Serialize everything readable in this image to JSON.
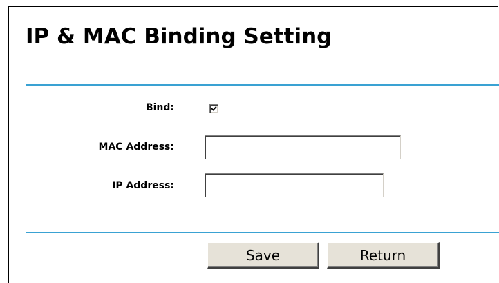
{
  "page": {
    "title": "IP & MAC Binding Setting"
  },
  "form": {
    "bind": {
      "label": "Bind:",
      "checked": true
    },
    "mac_address": {
      "label": "MAC Address:",
      "value": ""
    },
    "ip_address": {
      "label": "IP Address:",
      "value": ""
    }
  },
  "buttons": {
    "save_label": "Save",
    "return_label": "Return"
  },
  "colors": {
    "divider": "#3aa2d3",
    "button_face": "#e6e2d8"
  },
  "icons": {
    "bind_checkbox": "checkmark-icon"
  }
}
